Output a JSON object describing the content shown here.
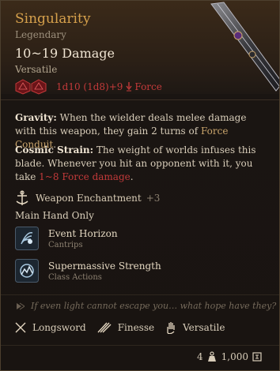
{
  "item": {
    "name": "Singularity",
    "rarity": "Legendary",
    "damage_range": "10~19 Damage",
    "damage_subtitle": "Versatile",
    "damage_formula": "1d10 (1d8)+9",
    "damage_type": "Force"
  },
  "description": {
    "gravity": {
      "label": "Gravity:",
      "text_before": " When the wielder deals melee damage with this weapon, they gain 2 turns of ",
      "link": "Force Conduit",
      "text_after": "."
    },
    "cosmic": {
      "label": "Cosmic Strain:",
      "text_before": " The weight of worlds infuses this blade. Whenever you hit an opponent with it, you take ",
      "damage": "1~8",
      "damage_type": "Force damage",
      "text_after": "."
    }
  },
  "enchantment": {
    "label": "Weapon Enchantment",
    "level": "+3"
  },
  "main_hand_label": "Main Hand Only",
  "actions": [
    {
      "name": "Event Horizon",
      "subtitle": "Cantrips",
      "icon": "event-horizon-icon"
    },
    {
      "name": "Supermassive Strength",
      "subtitle": "Class Actions",
      "icon": "supermassive-strength-icon"
    }
  ],
  "flavor_text": "If even light cannot escape you… what hope have they?",
  "properties": [
    {
      "label": "Longsword",
      "icon": "longsword-icon"
    },
    {
      "label": "Finesse",
      "icon": "finesse-icon"
    },
    {
      "label": "Versatile",
      "icon": "versatile-icon"
    }
  ],
  "footer": {
    "weight": "4",
    "price": "1,000"
  },
  "colors": {
    "title": "#d6a14c",
    "damage": "#c33a3a",
    "link": "#c9a46b",
    "border": "#4c3f2e"
  }
}
